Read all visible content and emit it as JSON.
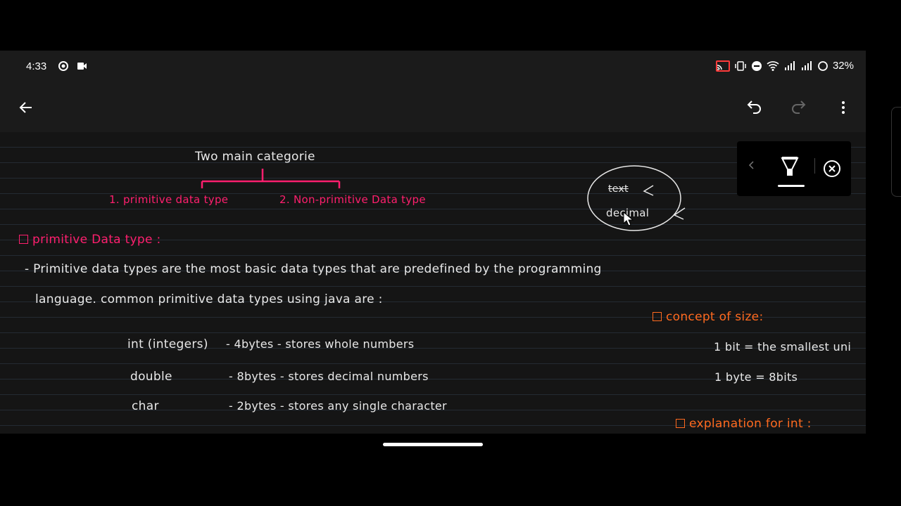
{
  "status": {
    "time": "4:33",
    "battery": "32%"
  },
  "notes": {
    "title": "Two main categorie",
    "cat1": "1. primitive data type",
    "cat2": "2. Non-primitive Data type",
    "circle_text": "text",
    "circle_text2": "decimal",
    "section1": "primitive Data type :",
    "line1": "- Primitive data types are the most basic data types that are predefined by the programming",
    "line2": "language. common primitive data types using java are :",
    "row1_name": "int (integers)",
    "row1_desc": "- 4bytes - stores whole numbers",
    "row2_name": "double",
    "row2_desc": "- 8bytes - stores decimal numbers",
    "row3_name": "char",
    "row3_desc": "- 2bytes - stores any single character",
    "section2": "concept of size:",
    "size1": "1 bit = the smallest uni",
    "size2": "1 byte = 8bits",
    "section3": "explanation for int :"
  },
  "colors": {
    "pink": "#ff1f6e",
    "orange": "#ff6a1f",
    "text": "#e8e8e8"
  }
}
